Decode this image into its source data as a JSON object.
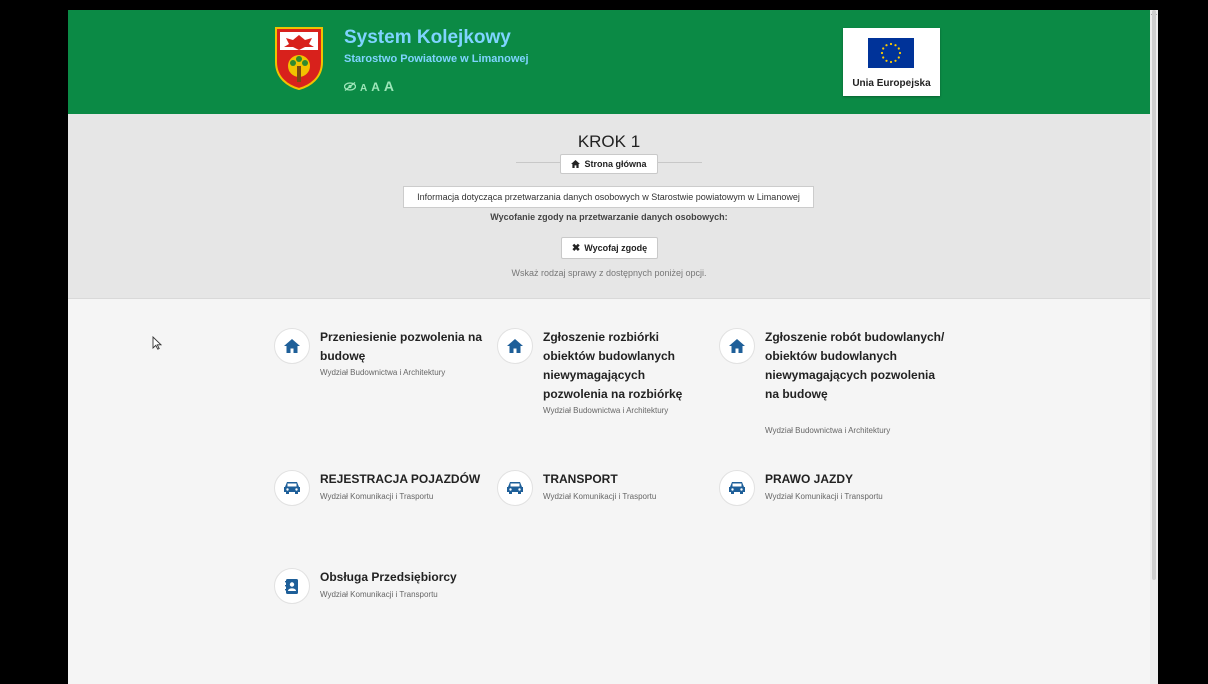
{
  "header": {
    "title": "System Kolejkowy",
    "subtitle": "Starostwo Powiatowe w Limanowej",
    "a11y_eye_icon": "eye-slash",
    "font_small": "A",
    "font_medium": "A",
    "font_large": "A",
    "eu_label": "Unia Europejska"
  },
  "step": {
    "title": "KROK 1",
    "home_button": "Strona główna",
    "info_button": "Informacja dotycząca przetwarzania danych osobowych w Starostwie powiatowym w Limanowej",
    "consent_label": "Wycofanie zgody na przetwarzanie danych osobowych:",
    "withdraw_button": "Wycofaj zgodę",
    "hint": "Wskaż rodzaj sprawy z dostępnych poniżej opcji."
  },
  "services": [
    {
      "icon": "home-icon",
      "title": "Przeniesienie pozwolenia na budowę",
      "department": "Wydział Budownictwa i Architektury"
    },
    {
      "icon": "home-icon",
      "title": "Zgłoszenie rozbiórki obiektów budowlanych niewymagających pozwolenia na rozbiórkę",
      "department": "Wydział Budownictwa i Architektury"
    },
    {
      "icon": "home-icon",
      "title": "Zgłoszenie robót budowlanych/ obiektów budowlanych niewymagających pozwolenia na budowę",
      "department": "Wydział Budownictwa i Architektury"
    },
    {
      "icon": "car-icon",
      "title": "REJESTRACJA POJAZDÓW",
      "department": "Wydział Komunikacji i Trasportu"
    },
    {
      "icon": "car-icon",
      "title": "TRANSPORT",
      "department": "Wydział Komunikacji i Trasportu"
    },
    {
      "icon": "car-icon",
      "title": "PRAWO JAZDY",
      "department": "Wydział Komunikacji i Transportu"
    },
    {
      "icon": "contact-book-icon",
      "title": "Obsługa Przedsiębiorcy",
      "department": "Wydział Komunikacji i Transportu"
    }
  ],
  "colors": {
    "header_bg": "#0b8a45",
    "title": "#7fd4ff",
    "icon": "#1e5f99",
    "eu_blue": "#003399",
    "eu_stars": "#ffcc00"
  }
}
